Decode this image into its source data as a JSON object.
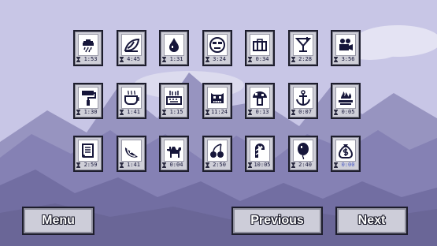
{
  "colors": {
    "sky": "#c8c6e6",
    "mountain_far": "#9794c0",
    "mountain_mid": "#7d79ad",
    "mountain_near": "#6b6798",
    "cloud": "#e4e3f3",
    "icon_ink": "#16163a",
    "time_unset": "#4a5ac6"
  },
  "levels": [
    {
      "icon": "rain-cloud-icon",
      "time": "1:53"
    },
    {
      "icon": "swirl-leaf-icon",
      "time": "4:45"
    },
    {
      "icon": "water-drop-icon",
      "time": "1:31"
    },
    {
      "icon": "grumpy-face-icon",
      "time": "3:24"
    },
    {
      "icon": "briefcase-icon",
      "time": "0:34"
    },
    {
      "icon": "cocktail-glass-icon",
      "time": "2:28"
    },
    {
      "icon": "movie-camera-icon",
      "time": "3:56"
    },
    {
      "icon": "paint-roller-icon",
      "time": "1:30"
    },
    {
      "icon": "coffee-cup-icon",
      "time": "1:41"
    },
    {
      "icon": "keyboard-hands-icon",
      "time": "1:15"
    },
    {
      "icon": "monster-face-icon",
      "time": "11:24"
    },
    {
      "icon": "mushroom-icon",
      "time": "0:13"
    },
    {
      "icon": "anchor-icon",
      "time": "0:07"
    },
    {
      "icon": "campfire-icon",
      "time": "0:05"
    },
    {
      "icon": "scroll-icon",
      "time": "2:59"
    },
    {
      "icon": "melon-slice-icon",
      "time": "1:41"
    },
    {
      "icon": "camel-icon",
      "time": "0:04"
    },
    {
      "icon": "cherries-icon",
      "time": "2:50"
    },
    {
      "icon": "candy-cane-icon",
      "time": "10:05"
    },
    {
      "icon": "balloon-icon",
      "time": "2:40"
    },
    {
      "icon": "money-bag-icon",
      "time": "0:00",
      "unset": true
    }
  ],
  "buttons": {
    "menu": "Menu",
    "previous": "Previous",
    "next": "Next"
  }
}
